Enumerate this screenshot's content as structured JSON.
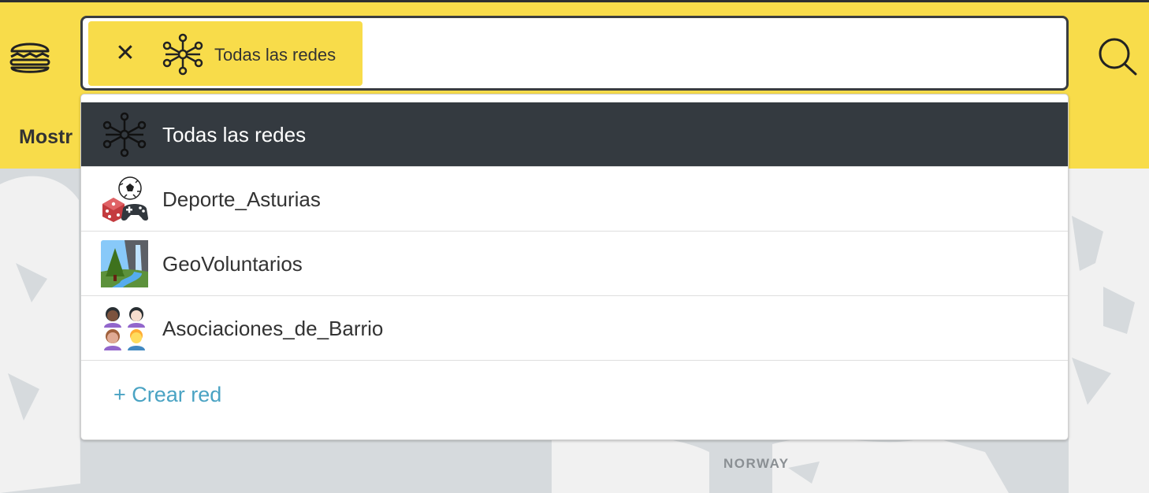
{
  "header": {
    "menu_icon": "burger-icon",
    "search_icon": "search-icon",
    "mostrar_label": "Mostr"
  },
  "search": {
    "selected_chip": {
      "label": "Todas las redes",
      "icon": "network-icon",
      "close_icon": "close-icon",
      "close_glyph": "✕"
    }
  },
  "dropdown": {
    "items": [
      {
        "label": "Todas las redes",
        "icon": "network-icon",
        "selected": true
      },
      {
        "label": "Deporte_Asturias",
        "icon": "sports-games-icon",
        "selected": false
      },
      {
        "label": "GeoVoluntarios",
        "icon": "landscape-icon",
        "selected": false
      },
      {
        "label": "Asociaciones_de_Barrio",
        "icon": "people-group-icon",
        "selected": false
      }
    ],
    "create_label": "+ Crear red"
  },
  "map": {
    "label": "NORWAY"
  },
  "colors": {
    "brand_yellow": "#f8dc4a",
    "active_row": "#343a40",
    "link": "#4aa3c3",
    "map_bg": "#d6dadd"
  }
}
